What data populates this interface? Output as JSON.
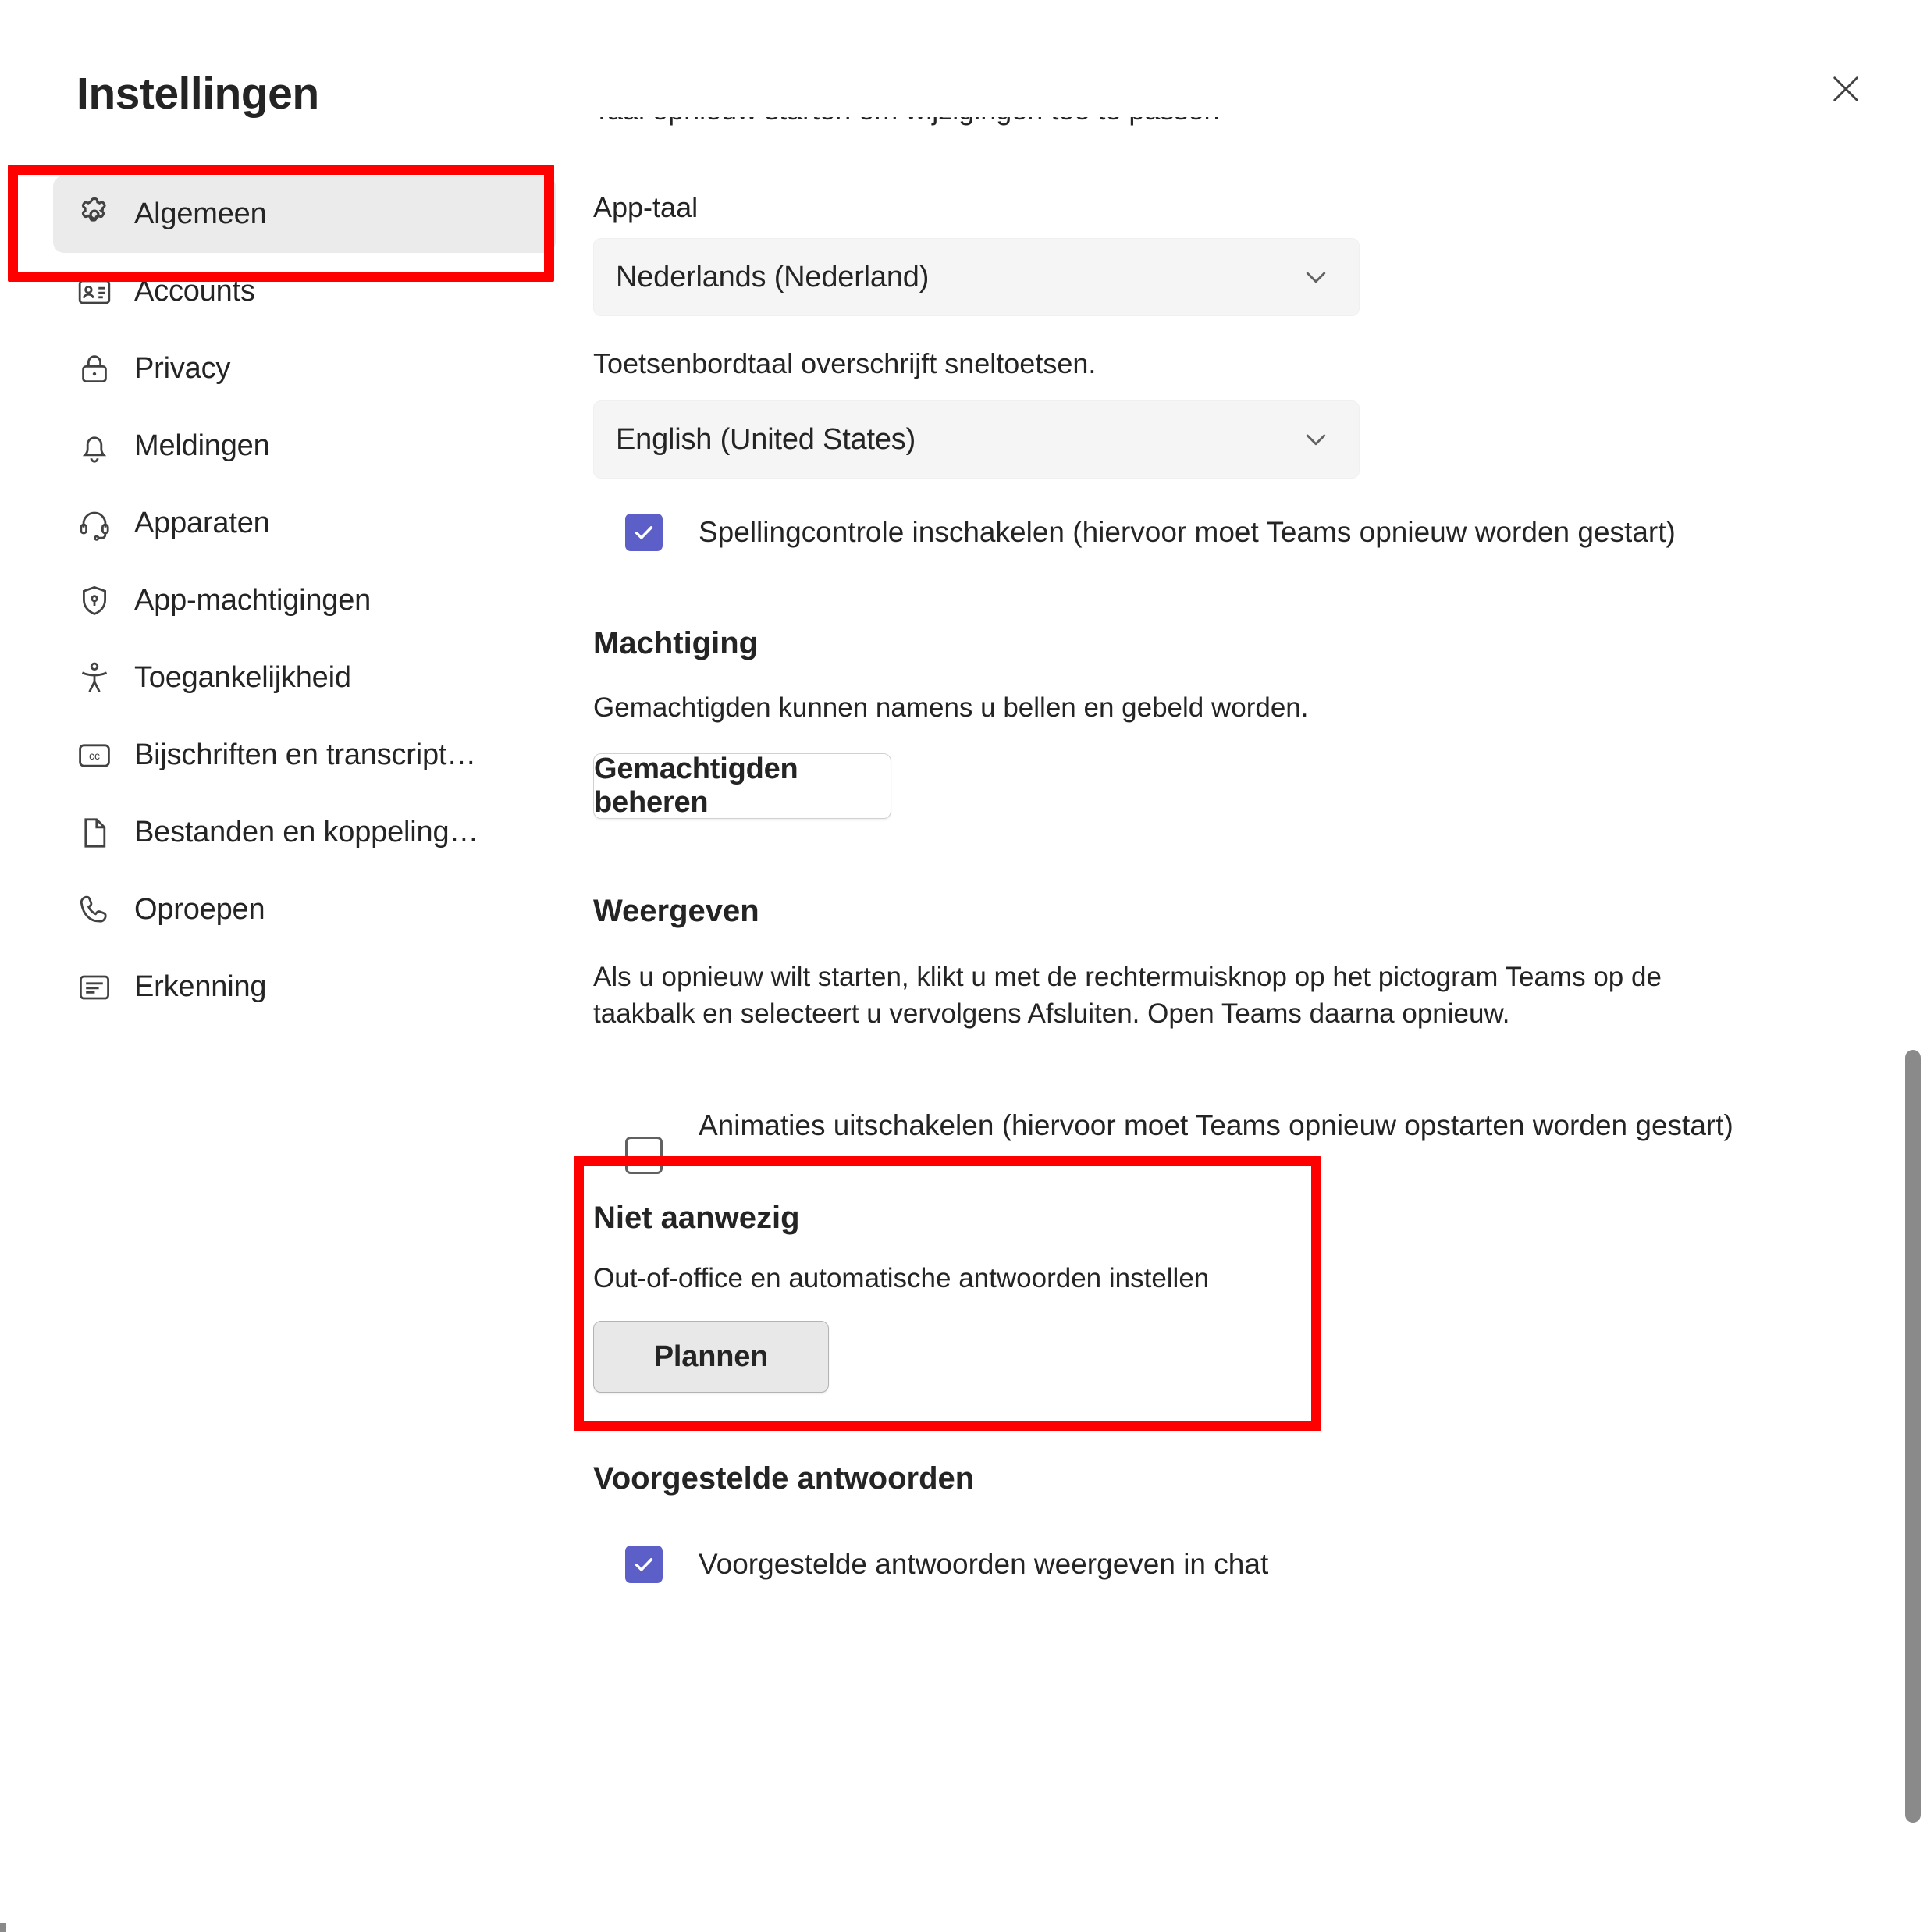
{
  "window": {
    "title": "Instellingen",
    "close_icon": "close-icon"
  },
  "sidebar": {
    "items": [
      {
        "label": "Algemeen",
        "icon": "gear-icon",
        "selected": true
      },
      {
        "label": "Accounts",
        "icon": "contact-card-icon",
        "selected": false
      },
      {
        "label": "Privacy",
        "icon": "lock-icon",
        "selected": false
      },
      {
        "label": "Meldingen",
        "icon": "bell-icon",
        "selected": false
      },
      {
        "label": "Apparaten",
        "icon": "headset-icon",
        "selected": false
      },
      {
        "label": "App-machtigingen",
        "icon": "shield-key-icon",
        "selected": false
      },
      {
        "label": "Toegankelijkheid",
        "icon": "accessibility-icon",
        "selected": false
      },
      {
        "label": "Bijschriften en transcript…",
        "icon": "closed-caption-icon",
        "selected": false
      },
      {
        "label": "Bestanden en koppeling…",
        "icon": "document-icon",
        "selected": false
      },
      {
        "label": "Oproepen",
        "icon": "phone-icon",
        "selected": false
      },
      {
        "label": "Erkenning",
        "icon": "list-document-icon",
        "selected": false
      }
    ]
  },
  "main": {
    "clipped_text": "Taal opnieuw starten om wijzigingen toe te passen",
    "app_language": {
      "label": "App-taal",
      "value": "Nederlands (Nederland)",
      "caret_icon": "chevron-down-icon"
    },
    "keyboard_language": {
      "label": "Toetsenbordtaal overschrijft sneltoetsen.",
      "value": "English (United States)",
      "caret_icon": "chevron-down-icon"
    },
    "spellcheck": {
      "label": "Spellingcontrole inschakelen (hiervoor moet Teams opnieuw worden gestart)",
      "checked": true
    },
    "machtiging": {
      "heading": "Machtiging",
      "description": "Gemachtigden kunnen namens u bellen en gebeld worden.",
      "button_label": "Gemachtigden beheren"
    },
    "weergeven": {
      "heading": "Weergeven",
      "description": "Als u opnieuw wilt starten, klikt u met de rechtermuisknop op het pictogram Teams op de taakbalk en selecteert u vervolgens Afsluiten. Open Teams daarna opnieuw.",
      "animations": {
        "label": "Animaties uitschakelen (hiervoor moet Teams opnieuw opstarten worden gestart)",
        "checked": false
      }
    },
    "niet_aanwezig": {
      "heading": "Niet aanwezig",
      "description": "Out-of-office en automatische antwoorden instellen",
      "button_label": "Plannen"
    },
    "voorgestelde_antwoorden": {
      "heading": "Voorgestelde antwoorden",
      "checkbox": {
        "label": "Voorgestelde antwoorden weergeven in chat",
        "checked": true
      }
    }
  },
  "colors": {
    "accent": "#5b5fc7",
    "highlight": "#ff0000",
    "selected_bg": "#ebebeb",
    "field_bg": "#f5f5f5"
  },
  "scrollbar": {
    "thumb_color": "#8a8a8a"
  }
}
